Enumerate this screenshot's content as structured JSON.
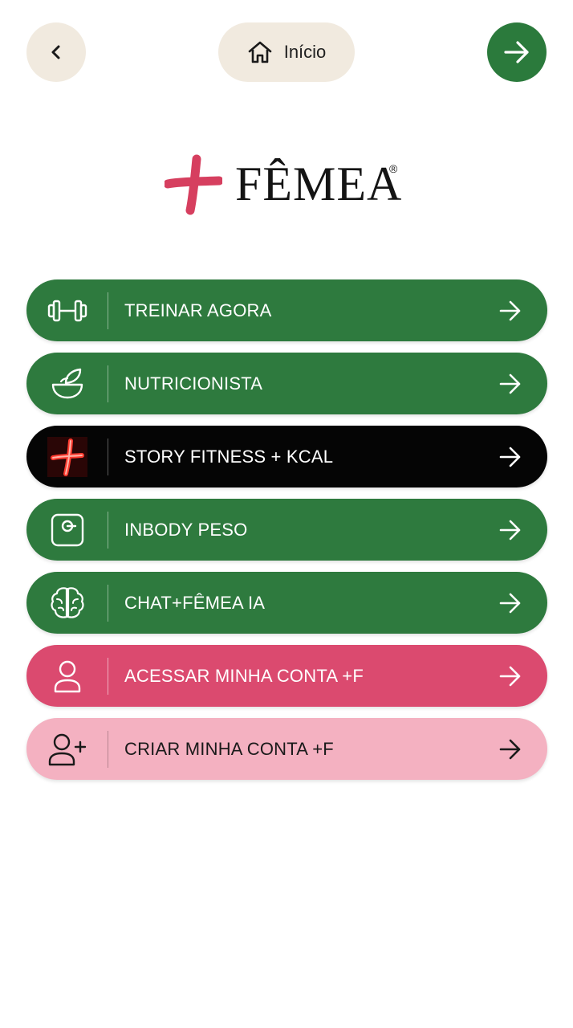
{
  "topbar": {
    "back_icon": "chevron-left-icon",
    "home_label": "Início",
    "home_icon": "home-icon",
    "forward_icon": "arrow-right-icon"
  },
  "logo": {
    "brand": "FÊMEA",
    "registered": "®",
    "cross_color": "#d63f5f"
  },
  "menu": {
    "items": [
      {
        "label": "TREINAR AGORA",
        "icon": "dumbbell-icon",
        "color": "#2e7a3e"
      },
      {
        "label": "NUTRICIONISTA",
        "icon": "salad-bowl-icon",
        "color": "#2e7a3e"
      },
      {
        "label": "STORY FITNESS + KCAL",
        "icon": "neon-cross-icon",
        "color": "#050505"
      },
      {
        "label": "INBODY PESO",
        "icon": "scale-icon",
        "color": "#2e7a3e"
      },
      {
        "label": "CHAT+FÊMEA IA",
        "icon": "brain-icon",
        "color": "#2e7a3e"
      },
      {
        "label": "ACESSAR MINHA CONTA +F",
        "icon": "user-icon",
        "color": "#db4a6f"
      },
      {
        "label": "CRIAR MINHA CONTA +F",
        "icon": "user-plus-icon",
        "color": "#f4b1c1"
      }
    ]
  }
}
